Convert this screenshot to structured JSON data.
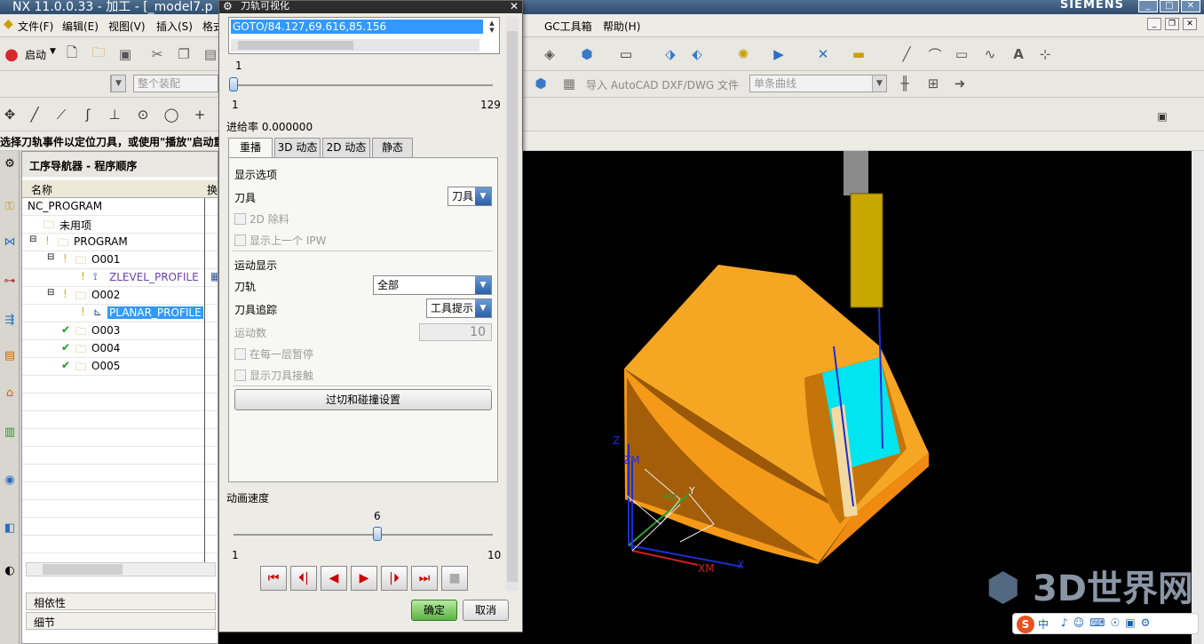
{
  "app": {
    "title": "NX 11.0.0.33 - 加工 - [_model7.p",
    "brand": "SIEMENS",
    "window_buttons": [
      "_",
      "□",
      "✕"
    ]
  },
  "menu": [
    "文件(F)",
    "编辑(E)",
    "视图(V)",
    "插入(S)",
    "格式",
    "GC工具箱",
    "帮助(H)"
  ],
  "toolbar": {
    "start_label": "启动",
    "filter_placeholder": "整个装配",
    "export_label": "导入 AutoCAD DXF/DWG 文件",
    "curve_filter": "单条曲线"
  },
  "status_message": "选择刀轨事件以定位刀具，或使用\"播放\"启动重",
  "navigator": {
    "title": "工序导航器 - 程序顺序",
    "col_name": "名称",
    "col_2": "换",
    "rows": [
      {
        "label": "NC_PROGRAM",
        "indent": 0,
        "icon": "",
        "type": "root"
      },
      {
        "label": "未用项",
        "indent": 1,
        "icon": "folder-icon",
        "type": "folder"
      },
      {
        "label": "PROGRAM",
        "indent": 1,
        "icon": "folder-icon",
        "type": "folder"
      },
      {
        "label": "O001",
        "indent": 2,
        "icon": "folder-icon",
        "type": "folder"
      },
      {
        "label": "ZLEVEL_PROFILE",
        "indent": 3,
        "icon": "operation-icon",
        "type": "op"
      },
      {
        "label": "O002",
        "indent": 2,
        "icon": "folder-icon",
        "type": "folder"
      },
      {
        "label": "PLANAR_PROFILE",
        "indent": 3,
        "icon": "operation-icon",
        "type": "op-selected"
      },
      {
        "label": "O003",
        "indent": 2,
        "icon": "folder-icon",
        "type": "done"
      },
      {
        "label": "O004",
        "indent": 2,
        "icon": "folder-icon",
        "type": "done"
      },
      {
        "label": "O005",
        "indent": 2,
        "icon": "folder-icon",
        "type": "done"
      }
    ],
    "panel_dependency": "相依性",
    "panel_details": "细节"
  },
  "dialog": {
    "title": "刀轨可视化",
    "goto_value": "GOTO/84.127,69.616,85.156",
    "position_top": "1",
    "position_min": "1",
    "position_max": "129",
    "position_value": 1,
    "feed_rate": "进给率 0.000000",
    "tabs": [
      "重播",
      "3D 动态",
      "2D 动态",
      "静态"
    ],
    "display_options": "显示选项",
    "tool_label": "刀具",
    "tool_value": "刀具",
    "chk_2d_stock": "2D 除料",
    "chk_prev_ipw": "显示上一个 IPW",
    "motion_display": "运动显示",
    "path_label": "刀轨",
    "path_value": "全部",
    "trace_label": "刀具追踪",
    "trace_value": "工具提示",
    "motion_count_label": "运动数",
    "motion_count_value": "10",
    "chk_pause_layer": "在每一层暂停",
    "chk_show_contact": "显示刀具接触",
    "gouge_button": "过切和碰撞设置",
    "anim_speed_label": "动画速度",
    "speed_value_label": "6",
    "speed_min": "1",
    "speed_max": "10",
    "speed_value": 6,
    "ok": "确定",
    "cancel": "取消"
  },
  "viewport": {
    "axis_labels": [
      "Z",
      "ZM",
      "YM",
      "Y",
      "XM",
      "X"
    ]
  },
  "watermark": "3D世界网",
  "ime": {
    "s": "S",
    "zh": "中"
  },
  "colors": {
    "part": "#f5a623",
    "part_dark": "#b86a08",
    "cyan": "#00e5f0",
    "tool": "#c8a800"
  }
}
